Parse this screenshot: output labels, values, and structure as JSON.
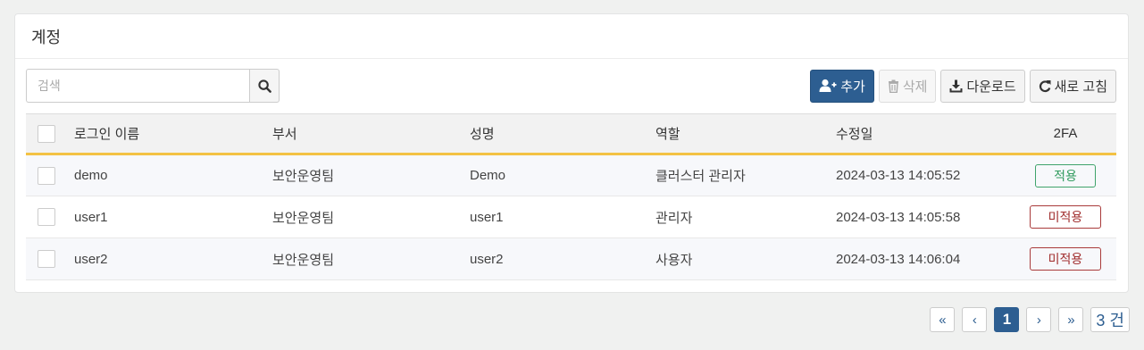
{
  "panel": {
    "title": "계정"
  },
  "search": {
    "placeholder": "검색"
  },
  "toolbar": {
    "add_label": "추가",
    "delete_label": "삭제",
    "download_label": "다운로드",
    "refresh_label": "새로 고침"
  },
  "table": {
    "headers": {
      "login": "로그인 이름",
      "dept": "부서",
      "name": "성명",
      "role": "역할",
      "modified": "수정일",
      "twofa": "2FA"
    },
    "rows": [
      {
        "login": "demo",
        "dept": "보안운영팀",
        "name": "Demo",
        "role": "클러스터 관리자",
        "modified": "2024-03-13 14:05:52",
        "twofa": "적용"
      },
      {
        "login": "user1",
        "dept": "보안운영팀",
        "name": "user1",
        "role": "관리자",
        "modified": "2024-03-13 14:05:58",
        "twofa": "미적용"
      },
      {
        "login": "user2",
        "dept": "보안운영팀",
        "name": "user2",
        "role": "사용자",
        "modified": "2024-03-13 14:06:04",
        "twofa": "미적용"
      }
    ]
  },
  "pagination": {
    "first": "«",
    "prev": "‹",
    "current": "1",
    "next": "›",
    "last": "»",
    "total": "3 건"
  },
  "colors": {
    "primary": "#2d5e91",
    "header_accent": "#f3c244",
    "badge_on": "#2f9a5d",
    "badge_off": "#a02c2c"
  },
  "icons": {
    "search": "search-icon",
    "add": "user-plus-icon",
    "delete": "trash-icon",
    "download": "download-icon",
    "refresh": "refresh-icon"
  }
}
